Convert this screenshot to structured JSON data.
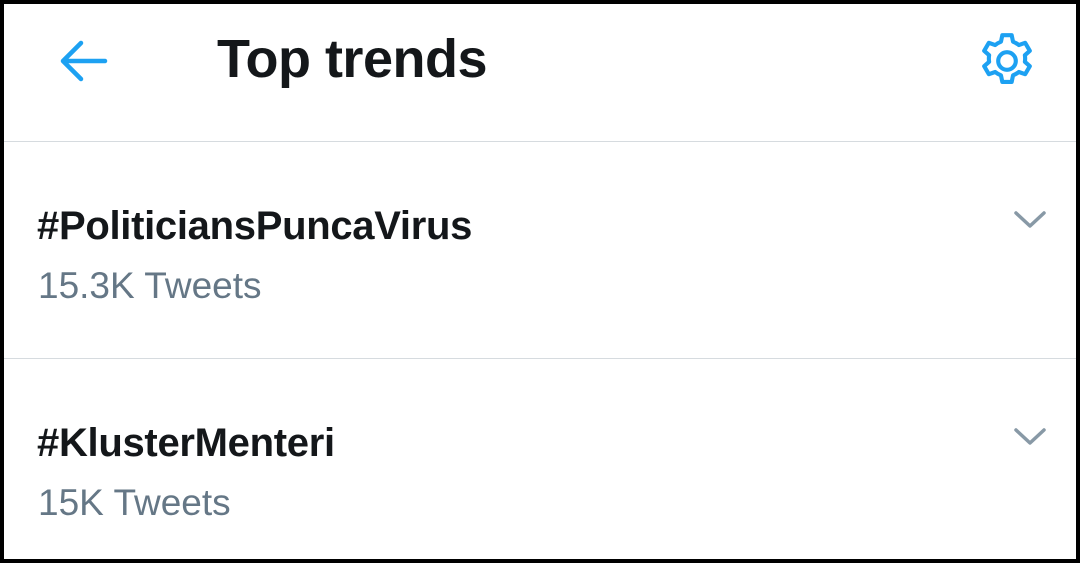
{
  "header": {
    "title": "Top trends",
    "back_icon": "arrow-left-icon",
    "settings_icon": "gear-icon"
  },
  "trends": [
    {
      "name": "#PoliticiansPuncaVirus",
      "count": "15.3K Tweets"
    },
    {
      "name": "#KlusterMenteri",
      "count": "15K Tweets"
    }
  ],
  "colors": {
    "accent": "#1da1f2",
    "text_primary": "#14171a",
    "text_secondary": "#657786",
    "divider": "#d6dbdf"
  }
}
